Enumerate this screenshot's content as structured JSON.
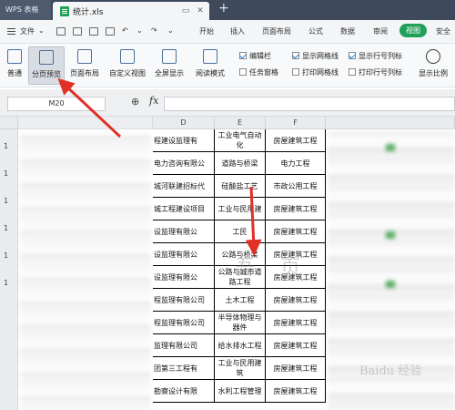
{
  "titlebar": {
    "app_tab": "WPS 表格",
    "file_tab": "统计.xls"
  },
  "menubar": {
    "file_menu": "文件",
    "items": [
      "开始",
      "插入",
      "页面布局",
      "公式",
      "数据",
      "审阅",
      "视图",
      "安全"
    ]
  },
  "ribbon": {
    "buttons": [
      "普通",
      "分页预览",
      "页面布局",
      "自定义视图",
      "全屏显示",
      "阅读模式"
    ],
    "checkboxes_col1": [
      "编辑栏",
      "任务窗格"
    ],
    "checkboxes_col2": [
      "显示网格线",
      "打印网格线"
    ],
    "checkboxes_col3": [
      "显示行号列标",
      "打印行号列标"
    ],
    "right_button": "显示比例"
  },
  "formulabar": {
    "name_box": "M20",
    "fx": "fx"
  },
  "columns": [
    "D",
    "E",
    "F"
  ],
  "rows": [
    {
      "d": "程建设监理有",
      "e": "工业电气自动化",
      "f": "房屋建筑工程"
    },
    {
      "d": "电力咨询有限公",
      "e": "道路与桥梁",
      "f": "电力工程"
    },
    {
      "d": "城河联建招标代",
      "e": "硅酸盐工艺",
      "f": "市政公用工程"
    },
    {
      "d": "城工程建设项目",
      "e": "工业与民用建",
      "f": "房屋建筑工程"
    },
    {
      "d": "设监理有限公",
      "e": "工民",
      "f": "房屋建筑工程"
    },
    {
      "d": "设监理有限公",
      "e": "公路与桥梁",
      "f": "房屋建筑工程"
    },
    {
      "d": "设监理有限公",
      "e": "公路与城市道路工程",
      "f": "房屋建筑工程"
    },
    {
      "d": "程监理有限公司",
      "e": "土木工程",
      "f": "房屋建筑工程"
    },
    {
      "d": "程监理有限公司",
      "e": "半导体物理与器件",
      "f": "房屋建筑工程"
    },
    {
      "d": "监理有限公司",
      "e": "给水排水工程",
      "f": "房屋建筑工程"
    },
    {
      "d": "团第三工程有",
      "e": "工业与民用建筑",
      "f": "房屋建筑工程"
    },
    {
      "d": "勘察设计有限",
      "e": "水利工程管理",
      "f": "房屋建筑工程"
    }
  ],
  "row_head_label": "1",
  "watermark": "Baidu 经验",
  "colors": {
    "accent": "#20a05a",
    "arrow": "#e03028"
  }
}
